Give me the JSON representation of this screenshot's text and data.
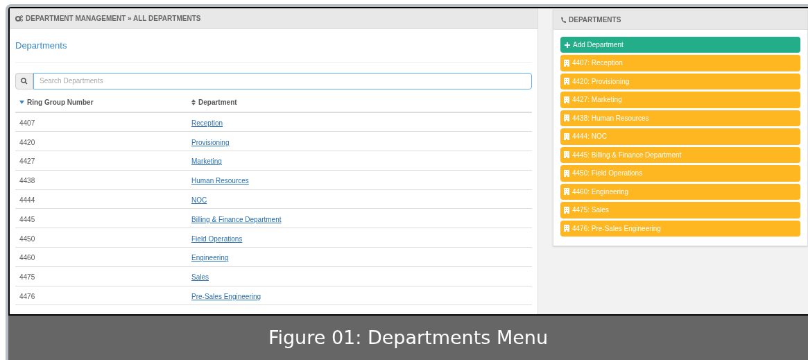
{
  "breadcrumb": "DEPARTMENT MANAGEMENT » ALL DEPARTMENTS",
  "panel_title": "Departments",
  "search": {
    "placeholder": "Search Departments"
  },
  "table": {
    "columns": [
      {
        "label": "Ring Group Number",
        "sorted": true
      },
      {
        "label": "Department",
        "sorted": false
      }
    ],
    "rows": [
      {
        "number": "4407",
        "department": "Reception"
      },
      {
        "number": "4420",
        "department": "Provisioning"
      },
      {
        "number": "4427",
        "department": "Marketing"
      },
      {
        "number": "4438",
        "department": "Human Resources"
      },
      {
        "number": "4444",
        "department": "NOC"
      },
      {
        "number": "4445",
        "department": "Billing & Finance Department"
      },
      {
        "number": "4450",
        "department": "Field Operations"
      },
      {
        "number": "4460",
        "department": "Engineering"
      },
      {
        "number": "4475",
        "department": "Sales"
      },
      {
        "number": "4476",
        "department": "Pre-Sales Engineering"
      }
    ]
  },
  "side_panel": {
    "title": "DEPARTMENTS",
    "add_button": "Add Department",
    "items": [
      "4407: Reception",
      "4420: Provisioning",
      "4427: Marketing",
      "4438: Human Resources",
      "4444: NOC",
      "4445: Billing & Finance Department",
      "4450: Field Operations",
      "4460: Engineering",
      "4475: Sales",
      "4476: Pre-Sales Engineering"
    ]
  },
  "caption": "Figure 01: Departments Menu"
}
